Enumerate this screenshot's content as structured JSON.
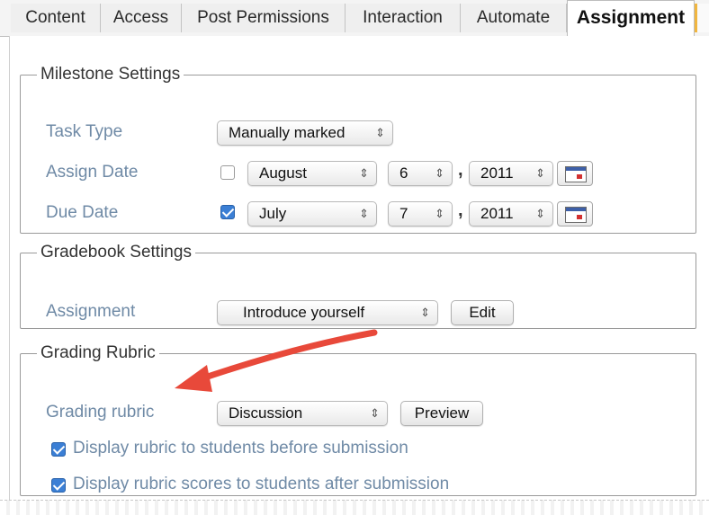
{
  "tabs": [
    {
      "label": "Content"
    },
    {
      "label": "Access"
    },
    {
      "label": "Post Permissions"
    },
    {
      "label": "Interaction"
    },
    {
      "label": "Automate"
    },
    {
      "label": "Assignment",
      "active": true
    }
  ],
  "milestone": {
    "legend": "Milestone Settings",
    "task_type": {
      "label": "Task Type",
      "value": "Manually marked"
    },
    "assign_date": {
      "label": "Assign Date",
      "checked": false,
      "month": "August",
      "day": "6",
      "year": "2011",
      "separator": ","
    },
    "due_date": {
      "label": "Due Date",
      "checked": true,
      "month": "July",
      "day": "7",
      "year": "2011",
      "separator": ","
    }
  },
  "gradebook": {
    "legend": "Gradebook Settings",
    "assignment": {
      "label": "Assignment",
      "value": "Introduce yourself",
      "edit_label": "Edit"
    }
  },
  "rubric": {
    "legend": "Grading Rubric",
    "grading_rubric": {
      "label": "Grading rubric",
      "value": "Discussion",
      "preview_label": "Preview"
    },
    "options": [
      {
        "label": "Display rubric to students before submission",
        "checked": true
      },
      {
        "label": "Display rubric scores to students after submission",
        "checked": true
      }
    ]
  },
  "colors": {
    "label_blue": "#6f8aa6",
    "annotation_arrow": "#e8493a",
    "active_tab_accent": "#f1b63f"
  },
  "icons": {
    "select_arrow": "updown-arrow-icon",
    "calendar": "calendar-icon",
    "annotation": "red-arrow-annotation"
  }
}
